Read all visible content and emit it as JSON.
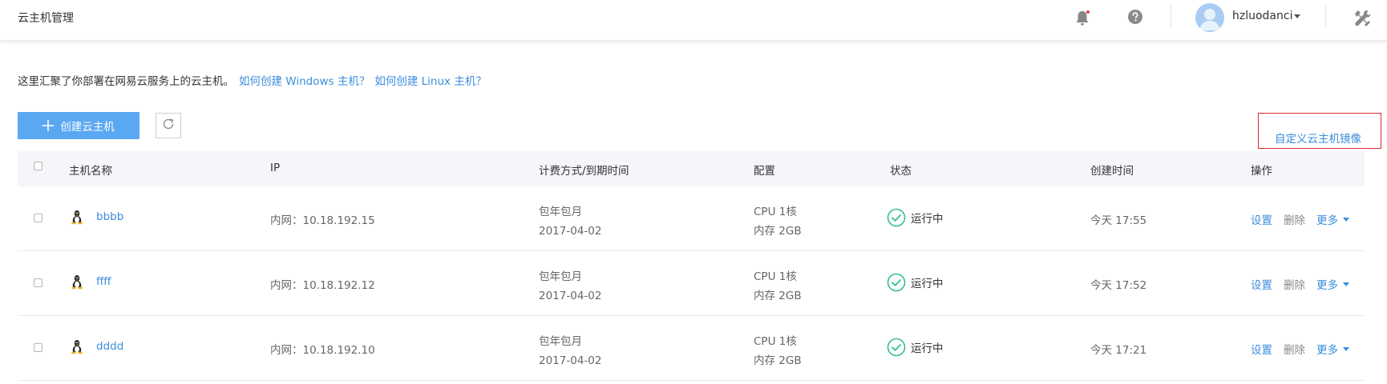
{
  "header": {
    "title": "云主机管理",
    "username": "hzluodanci"
  },
  "intro": {
    "text": "这里汇聚了你部署在网易云服务上的云主机。",
    "link_windows": "如何创建 Windows 主机？",
    "link_linux": "如何创建 Linux 主机？"
  },
  "toolbar": {
    "create_label": "创建云主机",
    "custom_image_label": "自定义云主机镜像"
  },
  "table": {
    "columns": {
      "name": "主机名称",
      "ip": "IP",
      "billing": "计费方式/到期时间",
      "config": "配置",
      "status": "状态",
      "created": "创建时间",
      "actions": "操作"
    },
    "rows": [
      {
        "name": "bbbb",
        "ip": "内网：10.18.192.15",
        "billing_type": "包年包月",
        "expire": "2017-04-02",
        "cpu": "CPU 1核",
        "memory": "内存 2GB",
        "status": "运行中",
        "created": "今天 17:55",
        "settings": "设置",
        "delete": "删除",
        "more": "更多"
      },
      {
        "name": "ffff",
        "ip": "内网：10.18.192.12",
        "billing_type": "包年包月",
        "expire": "2017-04-02",
        "cpu": "CPU 1核",
        "memory": "内存 2GB",
        "status": "运行中",
        "created": "今天 17:52",
        "settings": "设置",
        "delete": "删除",
        "more": "更多"
      },
      {
        "name": "dddd",
        "ip": "内网：10.18.192.10",
        "billing_type": "包年包月",
        "expire": "2017-04-02",
        "cpu": "CPU 1核",
        "memory": "内存 2GB",
        "status": "运行中",
        "created": "今天 17:21",
        "settings": "设置",
        "delete": "删除",
        "more": "更多"
      }
    ]
  },
  "colors": {
    "accent": "#3b8ddc",
    "primary_button": "#5ba8f2",
    "status_running": "#2fc08f",
    "highlight_frame": "#e0282e"
  },
  "icons": [
    "bell-icon",
    "help-icon",
    "avatar",
    "tools-icon",
    "plus-icon",
    "refresh-icon",
    "linux-icon",
    "running-check-icon",
    "caret-down-icon"
  ]
}
